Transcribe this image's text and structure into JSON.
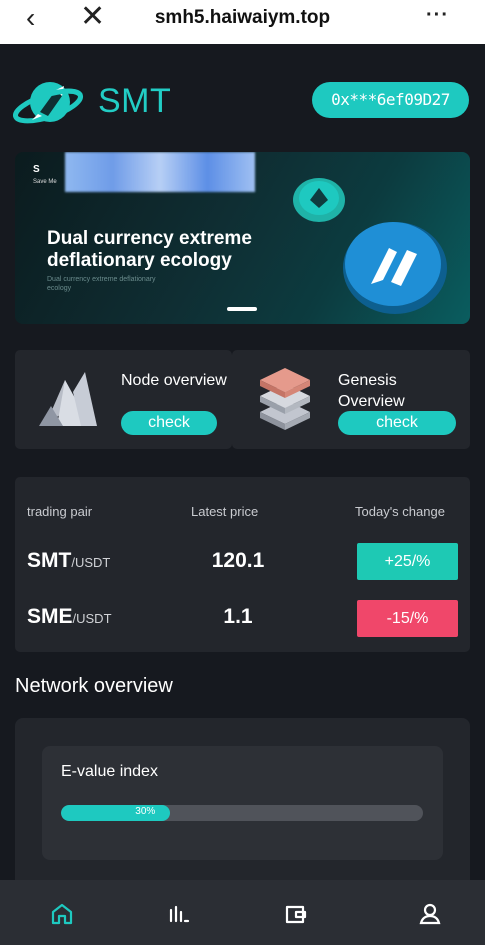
{
  "browser": {
    "back_icon": "chevron-left-icon",
    "close_icon": "close-icon",
    "url": "smh5.haiwaiym.top",
    "more": "···"
  },
  "header": {
    "brand": "SMT",
    "wallet_address": "0x***6ef09D27",
    "accent_color": "#1ec9c0"
  },
  "banner": {
    "logo_text": "Save Me",
    "headline": "Dual currency extreme deflationary ecology",
    "subline": "Dual currency extreme deflationary ecology"
  },
  "cards": [
    {
      "title": "Node overview",
      "button": "check",
      "icon": "crystal-mountain-icon"
    },
    {
      "title": "Genesis Overview",
      "button": "check",
      "icon": "layers-stack-icon"
    }
  ],
  "trading": {
    "headers": [
      "trading pair",
      "Latest price",
      "Today's change"
    ],
    "rows": [
      {
        "base": "SMT",
        "quote": "/USDT",
        "price": "120.1",
        "change": "+25/%",
        "change_color": "#1ec9b4"
      },
      {
        "base": "SME",
        "quote": "/USDT",
        "price": "1.1",
        "change": "-15/%",
        "change_color": "#f0476a"
      }
    ]
  },
  "network": {
    "title": "Network overview",
    "evalue_label": "E-value index",
    "progress_label": "30%",
    "progress_fraction": 0.3
  },
  "tabbar": {
    "items": [
      {
        "icon": "home-icon",
        "active": true
      },
      {
        "icon": "market-chart-icon",
        "active": false
      },
      {
        "icon": "wallet-icon",
        "active": false
      },
      {
        "icon": "user-icon",
        "active": false
      }
    ]
  }
}
